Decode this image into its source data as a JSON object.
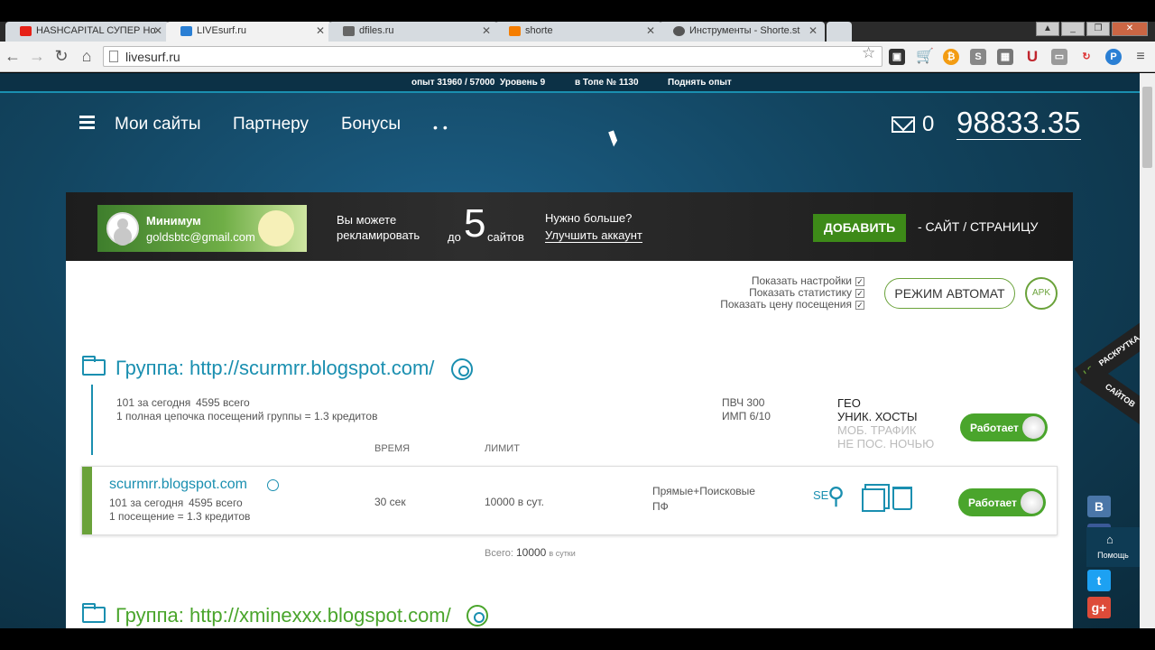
{
  "tabs": [
    {
      "title": "HASHCAPITAL СУПЕР Но",
      "color": "#e62117"
    },
    {
      "title": "LIVEsurf.ru",
      "color": "#2a7fd4"
    },
    {
      "title": "dfiles.ru",
      "color": "#666666"
    },
    {
      "title": "shorte",
      "color": "#f57d00"
    },
    {
      "title": "Инструменты - Shorte.st",
      "color": "#555555"
    }
  ],
  "address": "livesurf.ru",
  "topstat": {
    "exp": "опыт 31960 / 57000",
    "level": "Уровень 9",
    "top": "в Топе № 1130",
    "raise": "Поднять опыт"
  },
  "nav": {
    "my_sites": "Мои сайты",
    "partner": "Партнеру",
    "bonuses": "Бонусы",
    "more": "••",
    "mail_count": "0",
    "balance": "98833.35"
  },
  "banner": {
    "plan": "Минимум",
    "email": "goldsbtc@gmail.com",
    "can_advertise_1": "Вы можете",
    "can_advertise_2": "рекламировать",
    "upto": "до",
    "count": "5",
    "sites": "сайтов",
    "need_more": "Нужно больше?",
    "upgrade": "Улучшить аккаунт",
    "add_button": "ДОБАВИТЬ",
    "add_suffix": "- САЙТ / СТРАНИЦУ"
  },
  "options": {
    "show_settings": "Показать настройки",
    "show_stats": "Показать статистику",
    "show_price": "Показать цену посещения",
    "auto_mode": "РЕЖИМ АВТОМАТ",
    "apk": "APK"
  },
  "groups": [
    {
      "title": "Группа: http://scurmrr.blogspot.com/",
      "today": "101 за сегодня",
      "total": "4595 всего",
      "chain": "1 полная цепочка посещений группы = 1.3 кредитов",
      "pvch": "ПВЧ 300",
      "imp": "ИМП 6/10",
      "geo": "ГЕО",
      "unique": "УНИК. ХОСТЫ",
      "mobile": "МОБ. ТРАФИК",
      "night": "НЕ ПОС. НОЧЬЮ",
      "status": "Работает"
    },
    {
      "title": "Группа: http://xminexxx.blogspot.com/"
    }
  ],
  "columns": {
    "time": "ВРЕМЯ",
    "limit": "ЛИМИТ"
  },
  "site": {
    "name": "scurmrr.blogspot.com",
    "today": "101 за сегодня",
    "total": "4595 всего",
    "price": "1 посещение = 1.3 кредитов",
    "time": "30 сек",
    "limit": "10000 в сут.",
    "source_1": "Прямые+Поисковые",
    "source_2": "ПФ",
    "seo": "SE",
    "status": "Работает"
  },
  "total": {
    "label": "Всего:",
    "value": "10000",
    "unit": "в сутки"
  },
  "side_tab": {
    "ls": "LS",
    "line1": "РАСКРУТКА",
    "line2": "САЙТОВ"
  },
  "help": "Помощь"
}
